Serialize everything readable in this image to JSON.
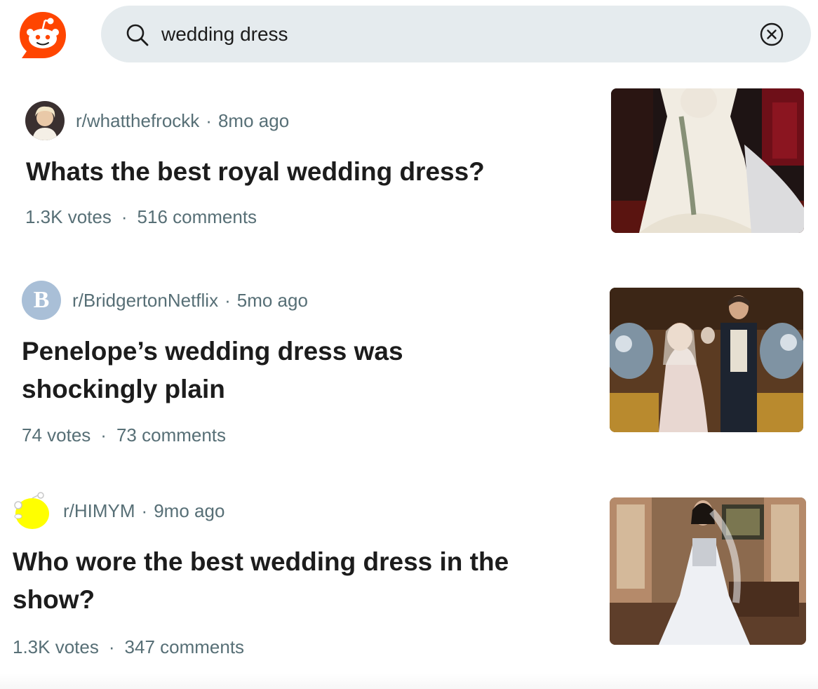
{
  "search": {
    "query": "wedding dress"
  },
  "posts": [
    {
      "subreddit": "r/whatthefrockk",
      "age": "8mo ago",
      "title": "Whats the best royal wedding dress?",
      "votes": "1.3K votes",
      "comments": "516 comments"
    },
    {
      "subreddit": "r/BridgertonNetflix",
      "age": "5mo ago",
      "avatar_letter": "B",
      "title_line1": "Penelope’s wedding dress was",
      "title_line2": "shockingly plain",
      "votes": "74 votes",
      "comments": "73 comments"
    },
    {
      "subreddit": "r/HIMYM",
      "age": "9mo ago",
      "title_line1": "Who wore the best wedding dress in the",
      "title_line2": "show?",
      "votes": "1.3K votes",
      "comments": "347 comments"
    }
  ],
  "separator": "·",
  "colors": {
    "brand": "#ff4500",
    "search_bg": "#e5ebee",
    "meta_text": "#576f76",
    "title_text": "#1c1c1c"
  },
  "icons": {
    "logo": "reddit-logo-icon",
    "search": "search-icon",
    "clear": "close-circle-icon"
  }
}
